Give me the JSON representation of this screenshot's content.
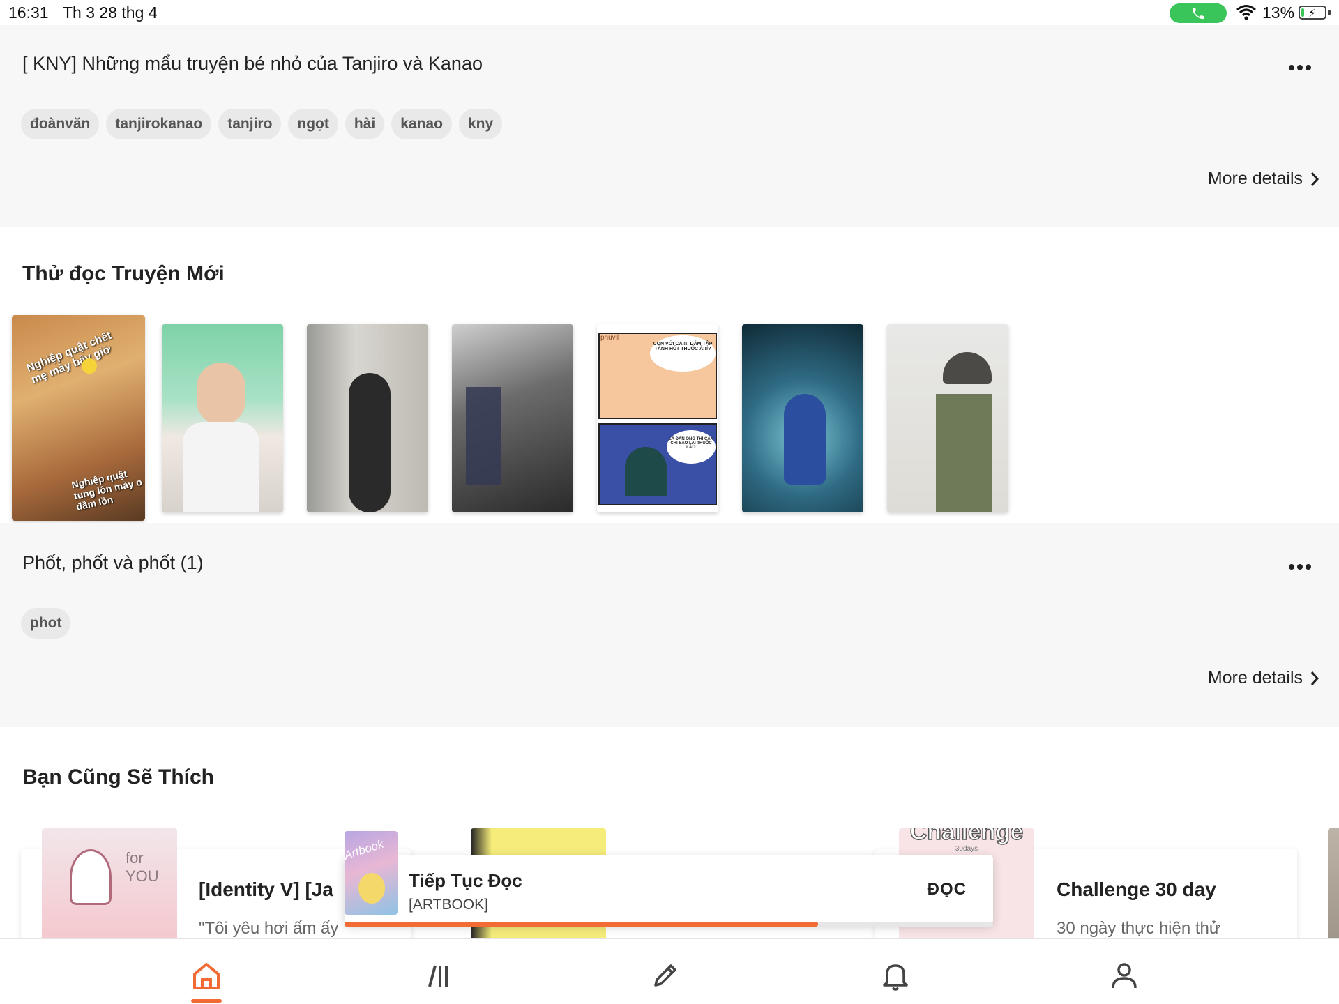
{
  "status_bar": {
    "time": "16:31",
    "date": "Th 3 28 thg 4",
    "battery_percent": "13%",
    "battery_level": 0.13
  },
  "story1": {
    "title": "[ KNY] Những mẩu truyện bé nhỏ của Tanjiro và Kanao",
    "tags": [
      "đoànvăn",
      "tanjirokanao",
      "tanjiro",
      "ngọt",
      "hài",
      "kanao",
      "kny"
    ],
    "more_details": "More details"
  },
  "new_stories": {
    "title": "Thử đọc Truyện Mới",
    "covers": [
      {
        "name": "cover-1",
        "texts": [
          "Nghiệp quật chết mẹ mày bây giờ",
          "Nghiệp quật tung lồn mày o đầm lồn"
        ]
      },
      {
        "name": "cover-2"
      },
      {
        "name": "cover-3"
      },
      {
        "name": "cover-4"
      },
      {
        "name": "cover-5",
        "texts": [
          "phuvil",
          "CON VỚI CÁI!!! DÁM TẬP TÀNH HÚT THUỐC À!!!?",
          "LÀ ĐÀN ÔNG THÌ CẦN CHI SAO LẠI THUỐC LÁ!?"
        ]
      },
      {
        "name": "cover-6"
      },
      {
        "name": "cover-7"
      }
    ]
  },
  "story2": {
    "title": "Phốt, phốt và phốt (1)",
    "tags": [
      "phot"
    ],
    "more_details": "More details"
  },
  "recommended": {
    "title": "Bạn Cũng Sẽ Thích",
    "items": [
      {
        "title": "[Identity V] [Ja",
        "desc": "\"Tôi yêu hơi ấm ấy",
        "thumb_text": "for YOU"
      },
      {
        "title": "Challenge 30 day",
        "desc": "30 ngày thực hiện thử",
        "thumb_text": "Challenge",
        "thumb_sub": "30days"
      }
    ]
  },
  "continue_reading": {
    "title": "Tiếp Tục Đọc",
    "subtitle": "[ARTBOOK]",
    "button": "ĐỌC",
    "thumb_text": "Artbook",
    "progress": 0.73
  },
  "tabbar": {
    "items": [
      "home-icon",
      "library-icon",
      "write-icon",
      "notifications-icon",
      "profile-icon"
    ],
    "active": "home-icon"
  },
  "colors": {
    "accent": "#f26b35",
    "call_green": "#3ac55a",
    "tag_bg": "#e9e9e9",
    "section_bg": "#f7f7f7"
  }
}
